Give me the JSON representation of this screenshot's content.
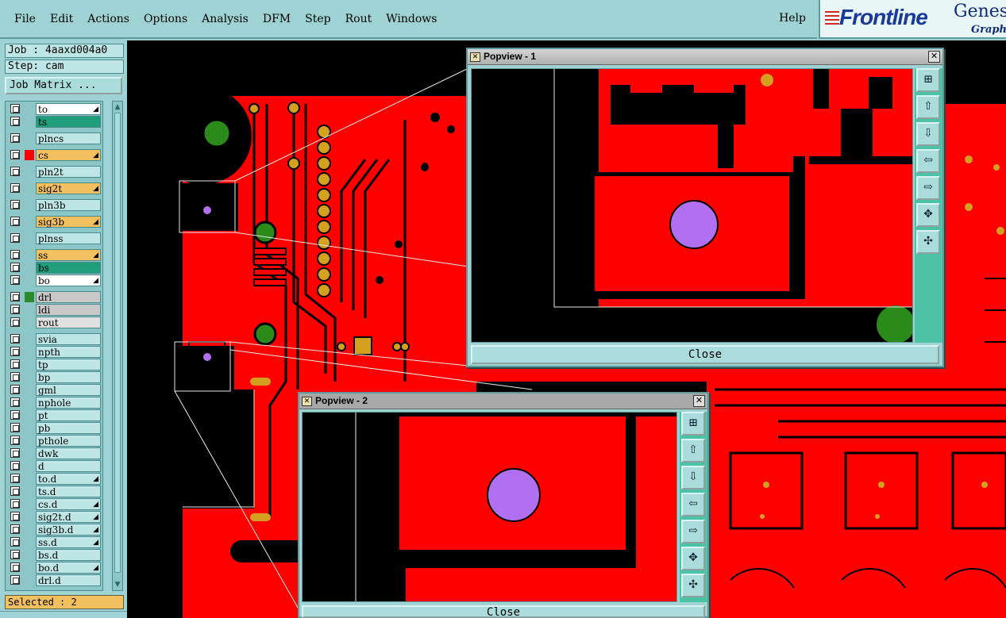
{
  "menubar": {
    "items": [
      "File",
      "Edit",
      "Actions",
      "Options",
      "Analysis",
      "DFM",
      "Step",
      "Rout",
      "Windows"
    ],
    "help": "Help"
  },
  "logo": {
    "brand": "Frontline",
    "product": "Genesi",
    "subtitle": "Graphic"
  },
  "job": {
    "job_line": "Job : 4aaxd004a0",
    "step_line": "Step: cam",
    "matrix_button": "Job Matrix ..."
  },
  "layers": [
    {
      "name": "to",
      "color": "#ffffff",
      "arrow": true
    },
    {
      "name": "ts",
      "color": "#1e9e7a",
      "arrow": false
    },
    {
      "name": "plncs",
      "color": "#bfe6e6",
      "arrow": false
    },
    {
      "name": "cs",
      "color": "#f3c060",
      "arrow": true,
      "swatch": "#ff0000"
    },
    {
      "name": "pln2t",
      "color": "#bfe6e6",
      "arrow": false
    },
    {
      "name": "sig2t",
      "color": "#f3c060",
      "arrow": true
    },
    {
      "name": "pln3b",
      "color": "#bfe6e6",
      "arrow": false
    },
    {
      "name": "sig3b",
      "color": "#f3c060",
      "arrow": true
    },
    {
      "name": "plnss",
      "color": "#bfe6e6",
      "arrow": false
    },
    {
      "name": "ss",
      "color": "#f3c060",
      "arrow": true
    },
    {
      "name": "bs",
      "color": "#1e9e7a",
      "arrow": false
    },
    {
      "name": "bo",
      "color": "#ffffff",
      "arrow": true
    },
    {
      "name": "drl",
      "color": "#c8c8c8",
      "arrow": false,
      "swatch": "#2a8a2a"
    },
    {
      "name": "ldi",
      "color": "#c8c8c8",
      "arrow": false
    },
    {
      "name": "rout",
      "color": "#e0e0e0",
      "arrow": false
    },
    {
      "name": "svia",
      "color": "#bfe6e6",
      "arrow": false
    },
    {
      "name": "npth",
      "color": "#bfe6e6",
      "arrow": false
    },
    {
      "name": "tp",
      "color": "#bfe6e6",
      "arrow": false
    },
    {
      "name": "bp",
      "color": "#bfe6e6",
      "arrow": false
    },
    {
      "name": "gml",
      "color": "#bfe6e6",
      "arrow": false
    },
    {
      "name": "nphole",
      "color": "#bfe6e6",
      "arrow": false
    },
    {
      "name": "pt",
      "color": "#bfe6e6",
      "arrow": false
    },
    {
      "name": "pb",
      "color": "#bfe6e6",
      "arrow": false
    },
    {
      "name": "pthole",
      "color": "#bfe6e6",
      "arrow": false
    },
    {
      "name": "dwk",
      "color": "#bfe6e6",
      "arrow": false
    },
    {
      "name": "d",
      "color": "#bfe6e6",
      "arrow": false
    },
    {
      "name": "to.d",
      "color": "#bfe6e6",
      "arrow": true
    },
    {
      "name": "ts.d",
      "color": "#bfe6e6",
      "arrow": false
    },
    {
      "name": "cs.d",
      "color": "#bfe6e6",
      "arrow": true
    },
    {
      "name": "sig2t.d",
      "color": "#bfe6e6",
      "arrow": true
    },
    {
      "name": "sig3b.d",
      "color": "#bfe6e6",
      "arrow": true
    },
    {
      "name": "ss.d",
      "color": "#bfe6e6",
      "arrow": true
    },
    {
      "name": "bs.d",
      "color": "#bfe6e6",
      "arrow": false
    },
    {
      "name": "bo.d",
      "color": "#bfe6e6",
      "arrow": true
    },
    {
      "name": "drl.d",
      "color": "#bfe6e6",
      "arrow": false
    }
  ],
  "selected": "Selected : 2",
  "popview1": {
    "title": "Popview - 1",
    "close": "Close"
  },
  "popview2": {
    "title": "Popview - 2",
    "close": "Close"
  },
  "colors": {
    "copper": "#ff0000",
    "pad": "#d4a020",
    "drill": "#2a8a1a",
    "via_highlight": "#b070f0",
    "background": "#000000",
    "ui": "#9fd3d3"
  }
}
